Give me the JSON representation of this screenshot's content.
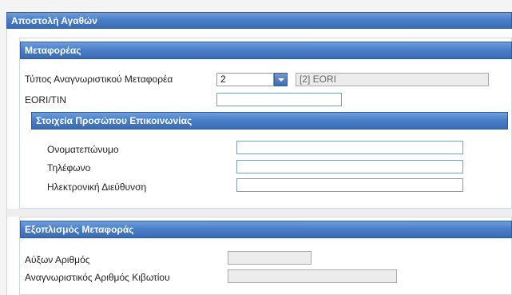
{
  "window": {
    "title": "Αποστολή Αγαθών"
  },
  "carrier": {
    "header": "Μεταφορέας",
    "id_type_label": "Τύπος Αναγνωριστικού Μεταφορέα",
    "id_type_value": "2",
    "id_type_desc": "[2] EORI",
    "eori_label": "EORI/TIN",
    "eori_value": ""
  },
  "contact": {
    "header": "Στοιχεία Προσώπου Επικοινωνίας",
    "name_label": "Ονοματεπώνυμο",
    "name_value": "",
    "phone_label": "Τηλέφωνο",
    "phone_value": "",
    "email_label": "Ηλεκτρονική Διεύθυνση",
    "email_value": ""
  },
  "equipment": {
    "header": "Εξοπλισμός Μεταφοράς",
    "seq_label": "Αύξων Αριθμός",
    "seq_value": "",
    "container_label": "Αναγνωριστικός Αριθμός Κιβωτίου",
    "container_value": ""
  }
}
